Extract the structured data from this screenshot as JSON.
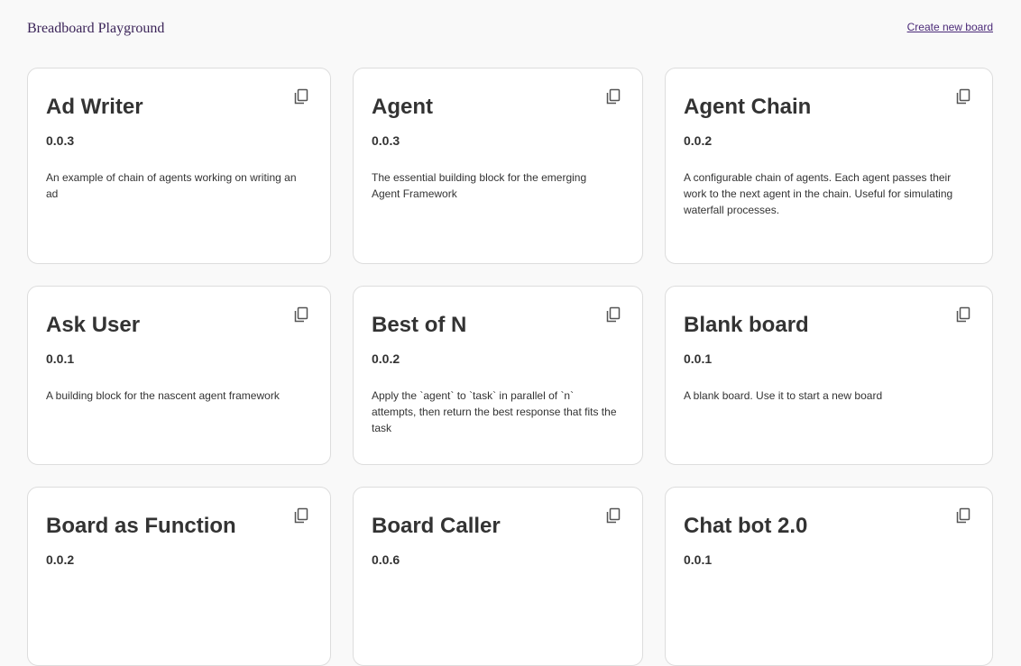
{
  "header": {
    "app_title": "Breadboard Playground",
    "create_link": "Create new board"
  },
  "boards": [
    {
      "title": "Ad Writer",
      "version": "0.0.3",
      "description": "An example of chain of agents working on writing an ad"
    },
    {
      "title": "Agent",
      "version": "0.0.3",
      "description": "The essential building block for the emerging Agent Framework"
    },
    {
      "title": "Agent Chain",
      "version": "0.0.2",
      "description": "A configurable chain of agents. Each agent passes their work to the next agent in the chain. Useful for simulating waterfall processes."
    },
    {
      "title": "Ask User",
      "version": "0.0.1",
      "description": "A building block for the nascent agent framework"
    },
    {
      "title": "Best of N",
      "version": "0.0.2",
      "description": "Apply the `agent` to `task` in parallel of `n` attempts, then return the best response that fits the task"
    },
    {
      "title": "Blank board",
      "version": "0.0.1",
      "description": "A blank board. Use it to start a new board"
    },
    {
      "title": "Board as Function",
      "version": "0.0.2",
      "description": ""
    },
    {
      "title": "Board Caller",
      "version": "0.0.6",
      "description": ""
    },
    {
      "title": "Chat bot 2.0",
      "version": "0.0.1",
      "description": ""
    }
  ],
  "icons": {
    "copy": "copy-icon"
  },
  "colors": {
    "accent": "#4b2a78",
    "title": "#3b2458",
    "card_border": "#dddddd",
    "background": "#f9f9f9"
  }
}
